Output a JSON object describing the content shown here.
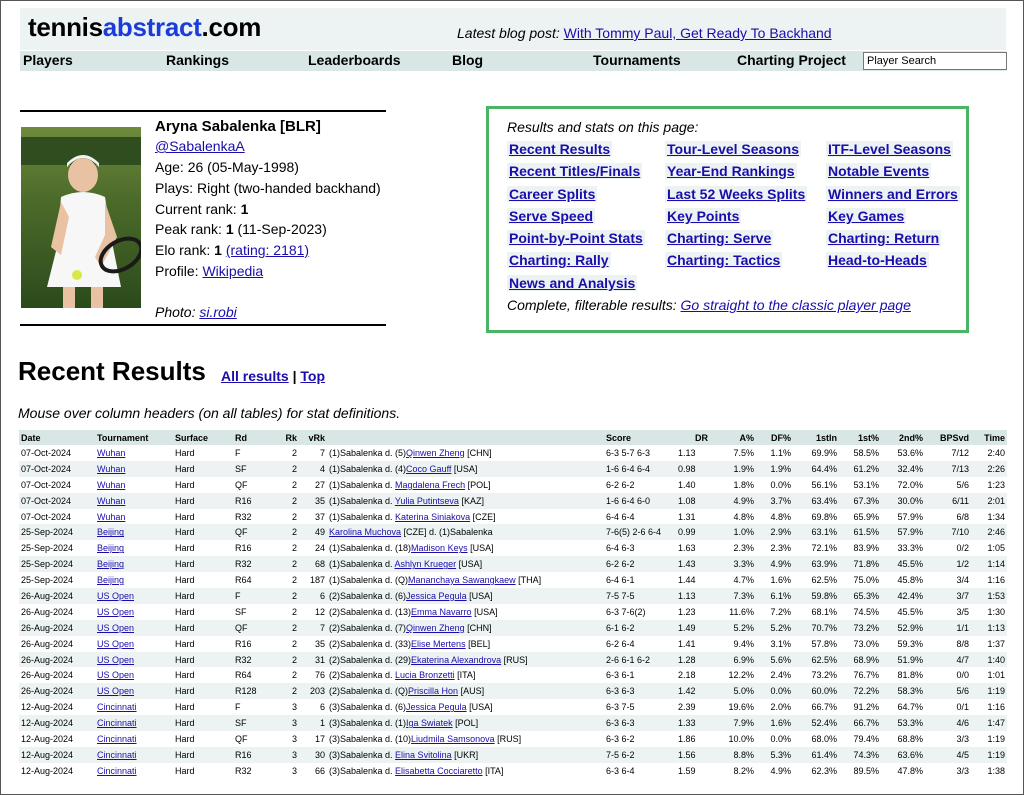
{
  "header": {
    "logo_left": "tennis",
    "logo_mid": "abstract",
    "logo_right": ".com",
    "blog_label": "Latest blog post:",
    "blog_link": "With Tommy Paul, Get Ready To Backhand"
  },
  "nav": {
    "items": [
      "Players",
      "Rankings",
      "Leaderboards",
      "Blog",
      "Tournaments",
      "Charting Project"
    ],
    "search_placeholder": "Player Search"
  },
  "player": {
    "name": "Aryna Sabalenka [BLR]",
    "handle": "@SabalenkaA",
    "age": "Age: 26 (05-May-1998)",
    "plays": "Plays: Right (two-handed backhand)",
    "current_rank_label": "Current rank: ",
    "current_rank": "1",
    "peak_rank_label": "Peak rank: ",
    "peak_rank": "1",
    "peak_rank_date": " (11-Sep-2023)",
    "elo_rank_label": "Elo rank: ",
    "elo_rank": "1",
    "elo_rating": "(rating: 2181)",
    "profile_label": "Profile: ",
    "profile_link": "Wikipedia",
    "photo_label": "Photo: ",
    "photo_credit": "si.robi"
  },
  "stats_box": {
    "heading": "Results and stats on this page:",
    "col1": [
      "Recent Results",
      "Recent Titles/Finals",
      "Career Splits",
      "Serve Speed",
      "Point-by-Point Stats",
      "Charting: Rally",
      "News and Analysis"
    ],
    "col2": [
      "Tour-Level Seasons",
      "Year-End Rankings",
      "Last 52 Weeks Splits",
      "Key Points",
      "Charting: Serve",
      "Charting: Tactics"
    ],
    "col3": [
      "ITF-Level Seasons",
      "Notable Events",
      "Winners and Errors",
      "Key Games",
      "Charting: Return",
      "Head-to-Heads"
    ],
    "footer_label": "Complete, filterable results:",
    "footer_link": "Go straight to the classic player page"
  },
  "recent": {
    "title": "Recent Results",
    "all_results": "All results",
    "separator": "|",
    "top": "Top",
    "note": "Mouse over column headers (on all tables) for stat definitions."
  },
  "table": {
    "columns": [
      "Date",
      "Tournament",
      "Surface",
      "Rd",
      "Rk",
      "vRk",
      "",
      "Score",
      "DR",
      "A%",
      "DF%",
      "1stIn",
      "1st%",
      "2nd%",
      "BPSvd",
      "Time"
    ],
    "rows": [
      {
        "date": "07-Oct-2024",
        "tour": "Wuhan",
        "surf": "Hard",
        "rd": "F",
        "rk": "2",
        "vrk": "7",
        "pre": "(1)Sabalenka d. (5)",
        "opp": "Qinwen Zheng",
        "post": " [CHN]",
        "score": "6-3 5-7 6-3",
        "dr": "1.13",
        "ace": "7.5%",
        "df": "1.1%",
        "in1": "69.9%",
        "w1": "58.5%",
        "w2": "53.6%",
        "bp": "7/12",
        "time": "2:40"
      },
      {
        "date": "07-Oct-2024",
        "tour": "Wuhan",
        "surf": "Hard",
        "rd": "SF",
        "rk": "2",
        "vrk": "4",
        "pre": "(1)Sabalenka d. (4)",
        "opp": "Coco Gauff",
        "post": " [USA]",
        "score": "1-6 6-4 6-4",
        "dr": "0.98",
        "ace": "1.9%",
        "df": "1.9%",
        "in1": "64.4%",
        "w1": "61.2%",
        "w2": "32.4%",
        "bp": "7/13",
        "time": "2:26"
      },
      {
        "date": "07-Oct-2024",
        "tour": "Wuhan",
        "surf": "Hard",
        "rd": "QF",
        "rk": "2",
        "vrk": "27",
        "pre": "(1)Sabalenka d. ",
        "opp": "Magdalena Frech",
        "post": " [POL]",
        "score": "6-2 6-2",
        "dr": "1.40",
        "ace": "1.8%",
        "df": "0.0%",
        "in1": "56.1%",
        "w1": "53.1%",
        "w2": "72.0%",
        "bp": "5/6",
        "time": "1:23"
      },
      {
        "date": "07-Oct-2024",
        "tour": "Wuhan",
        "surf": "Hard",
        "rd": "R16",
        "rk": "2",
        "vrk": "35",
        "pre": "(1)Sabalenka d. ",
        "opp": "Yulia Putintseva",
        "post": " [KAZ]",
        "score": "1-6 6-4 6-0",
        "dr": "1.08",
        "ace": "4.9%",
        "df": "3.7%",
        "in1": "63.4%",
        "w1": "67.3%",
        "w2": "30.0%",
        "bp": "6/11",
        "time": "2:01"
      },
      {
        "date": "07-Oct-2024",
        "tour": "Wuhan",
        "surf": "Hard",
        "rd": "R32",
        "rk": "2",
        "vrk": "37",
        "pre": "(1)Sabalenka d. ",
        "opp": "Katerina Siniakova",
        "post": " [CZE]",
        "score": "6-4 6-4",
        "dr": "1.31",
        "ace": "4.8%",
        "df": "4.8%",
        "in1": "69.8%",
        "w1": "65.9%",
        "w2": "57.9%",
        "bp": "6/8",
        "time": "1:34"
      },
      {
        "date": "25-Sep-2024",
        "tour": "Beijing",
        "surf": "Hard",
        "rd": "QF",
        "rk": "2",
        "vrk": "49",
        "pre": "",
        "opp": "Karolina Muchova",
        "post": " [CZE] d. (1)Sabalenka",
        "score": "7-6(5) 2-6 6-4",
        "dr": "0.99",
        "ace": "1.0%",
        "df": "2.9%",
        "in1": "63.1%",
        "w1": "61.5%",
        "w2": "57.9%",
        "bp": "7/10",
        "time": "2:46"
      },
      {
        "date": "25-Sep-2024",
        "tour": "Beijing",
        "surf": "Hard",
        "rd": "R16",
        "rk": "2",
        "vrk": "24",
        "pre": "(1)Sabalenka d. (18)",
        "opp": "Madison Keys",
        "post": " [USA]",
        "score": "6-4 6-3",
        "dr": "1.63",
        "ace": "2.3%",
        "df": "2.3%",
        "in1": "72.1%",
        "w1": "83.9%",
        "w2": "33.3%",
        "bp": "0/2",
        "time": "1:05"
      },
      {
        "date": "25-Sep-2024",
        "tour": "Beijing",
        "surf": "Hard",
        "rd": "R32",
        "rk": "2",
        "vrk": "68",
        "pre": "(1)Sabalenka d. ",
        "opp": "Ashlyn Krueger",
        "post": " [USA]",
        "score": "6-2 6-2",
        "dr": "1.43",
        "ace": "3.3%",
        "df": "4.9%",
        "in1": "63.9%",
        "w1": "71.8%",
        "w2": "45.5%",
        "bp": "1/2",
        "time": "1:14"
      },
      {
        "date": "25-Sep-2024",
        "tour": "Beijing",
        "surf": "Hard",
        "rd": "R64",
        "rk": "2",
        "vrk": "187",
        "pre": "(1)Sabalenka d. (Q)",
        "opp": "Mananchaya Sawangkaew",
        "post": " [THA]",
        "score": "6-4 6-1",
        "dr": "1.44",
        "ace": "4.7%",
        "df": "1.6%",
        "in1": "62.5%",
        "w1": "75.0%",
        "w2": "45.8%",
        "bp": "3/4",
        "time": "1:16"
      },
      {
        "date": "26-Aug-2024",
        "tour": "US Open",
        "surf": "Hard",
        "rd": "F",
        "rk": "2",
        "vrk": "6",
        "pre": "(2)Sabalenka d. (6)",
        "opp": "Jessica Pegula",
        "post": " [USA]",
        "score": "7-5 7-5",
        "dr": "1.13",
        "ace": "7.3%",
        "df": "6.1%",
        "in1": "59.8%",
        "w1": "65.3%",
        "w2": "42.4%",
        "bp": "3/7",
        "time": "1:53"
      },
      {
        "date": "26-Aug-2024",
        "tour": "US Open",
        "surf": "Hard",
        "rd": "SF",
        "rk": "2",
        "vrk": "12",
        "pre": "(2)Sabalenka d. (13)",
        "opp": "Emma Navarro",
        "post": " [USA]",
        "score": "6-3 7-6(2)",
        "dr": "1.23",
        "ace": "11.6%",
        "df": "7.2%",
        "in1": "68.1%",
        "w1": "74.5%",
        "w2": "45.5%",
        "bp": "3/5",
        "time": "1:30"
      },
      {
        "date": "26-Aug-2024",
        "tour": "US Open",
        "surf": "Hard",
        "rd": "QF",
        "rk": "2",
        "vrk": "7",
        "pre": "(2)Sabalenka d. (7)",
        "opp": "Qinwen Zheng",
        "post": " [CHN]",
        "score": "6-1 6-2",
        "dr": "1.49",
        "ace": "5.2%",
        "df": "5.2%",
        "in1": "70.7%",
        "w1": "73.2%",
        "w2": "52.9%",
        "bp": "1/1",
        "time": "1:13"
      },
      {
        "date": "26-Aug-2024",
        "tour": "US Open",
        "surf": "Hard",
        "rd": "R16",
        "rk": "2",
        "vrk": "35",
        "pre": "(2)Sabalenka d. (33)",
        "opp": "Elise Mertens",
        "post": " [BEL]",
        "score": "6-2 6-4",
        "dr": "1.41",
        "ace": "9.4%",
        "df": "3.1%",
        "in1": "57.8%",
        "w1": "73.0%",
        "w2": "59.3%",
        "bp": "8/8",
        "time": "1:37"
      },
      {
        "date": "26-Aug-2024",
        "tour": "US Open",
        "surf": "Hard",
        "rd": "R32",
        "rk": "2",
        "vrk": "31",
        "pre": "(2)Sabalenka d. (29)",
        "opp": "Ekaterina Alexandrova",
        "post": " [RUS]",
        "score": "2-6 6-1 6-2",
        "dr": "1.28",
        "ace": "6.9%",
        "df": "5.6%",
        "in1": "62.5%",
        "w1": "68.9%",
        "w2": "51.9%",
        "bp": "4/7",
        "time": "1:40"
      },
      {
        "date": "26-Aug-2024",
        "tour": "US Open",
        "surf": "Hard",
        "rd": "R64",
        "rk": "2",
        "vrk": "76",
        "pre": "(2)Sabalenka d. ",
        "opp": "Lucia Bronzetti",
        "post": " [ITA]",
        "score": "6-3 6-1",
        "dr": "2.18",
        "ace": "12.2%",
        "df": "2.4%",
        "in1": "73.2%",
        "w1": "76.7%",
        "w2": "81.8%",
        "bp": "0/0",
        "time": "1:01"
      },
      {
        "date": "26-Aug-2024",
        "tour": "US Open",
        "surf": "Hard",
        "rd": "R128",
        "rk": "2",
        "vrk": "203",
        "pre": "(2)Sabalenka d. (Q)",
        "opp": "Priscilla Hon",
        "post": " [AUS]",
        "score": "6-3 6-3",
        "dr": "1.42",
        "ace": "5.0%",
        "df": "0.0%",
        "in1": "60.0%",
        "w1": "72.2%",
        "w2": "58.3%",
        "bp": "5/6",
        "time": "1:19"
      },
      {
        "date": "12-Aug-2024",
        "tour": "Cincinnati",
        "surf": "Hard",
        "rd": "F",
        "rk": "3",
        "vrk": "6",
        "pre": "(3)Sabalenka d. (6)",
        "opp": "Jessica Pegula",
        "post": " [USA]",
        "score": "6-3 7-5",
        "dr": "2.39",
        "ace": "19.6%",
        "df": "2.0%",
        "in1": "66.7%",
        "w1": "91.2%",
        "w2": "64.7%",
        "bp": "0/1",
        "time": "1:16"
      },
      {
        "date": "12-Aug-2024",
        "tour": "Cincinnati",
        "surf": "Hard",
        "rd": "SF",
        "rk": "3",
        "vrk": "1",
        "pre": "(3)Sabalenka d. (1)",
        "opp": "Iga Swiatek",
        "post": " [POL]",
        "score": "6-3 6-3",
        "dr": "1.33",
        "ace": "7.9%",
        "df": "1.6%",
        "in1": "52.4%",
        "w1": "66.7%",
        "w2": "53.3%",
        "bp": "4/6",
        "time": "1:47"
      },
      {
        "date": "12-Aug-2024",
        "tour": "Cincinnati",
        "surf": "Hard",
        "rd": "QF",
        "rk": "3",
        "vrk": "17",
        "pre": "(3)Sabalenka d. (10)",
        "opp": "Liudmila Samsonova",
        "post": " [RUS]",
        "score": "6-3 6-2",
        "dr": "1.86",
        "ace": "10.0%",
        "df": "0.0%",
        "in1": "68.0%",
        "w1": "79.4%",
        "w2": "68.8%",
        "bp": "3/3",
        "time": "1:19"
      },
      {
        "date": "12-Aug-2024",
        "tour": "Cincinnati",
        "surf": "Hard",
        "rd": "R16",
        "rk": "3",
        "vrk": "30",
        "pre": "(3)Sabalenka d. ",
        "opp": "Elina Svitolina",
        "post": " [UKR]",
        "score": "7-5 6-2",
        "dr": "1.56",
        "ace": "8.8%",
        "df": "5.3%",
        "in1": "61.4%",
        "w1": "74.3%",
        "w2": "63.6%",
        "bp": "4/5",
        "time": "1:19"
      },
      {
        "date": "12-Aug-2024",
        "tour": "Cincinnati",
        "surf": "Hard",
        "rd": "R32",
        "rk": "3",
        "vrk": "66",
        "pre": "(3)Sabalenka d. ",
        "opp": "Elisabetta Cocciaretto",
        "post": " [ITA]",
        "score": "6-3 6-4",
        "dr": "1.59",
        "ace": "8.2%",
        "df": "4.9%",
        "in1": "62.3%",
        "w1": "89.5%",
        "w2": "47.8%",
        "bp": "3/3",
        "time": "1:38"
      }
    ]
  }
}
